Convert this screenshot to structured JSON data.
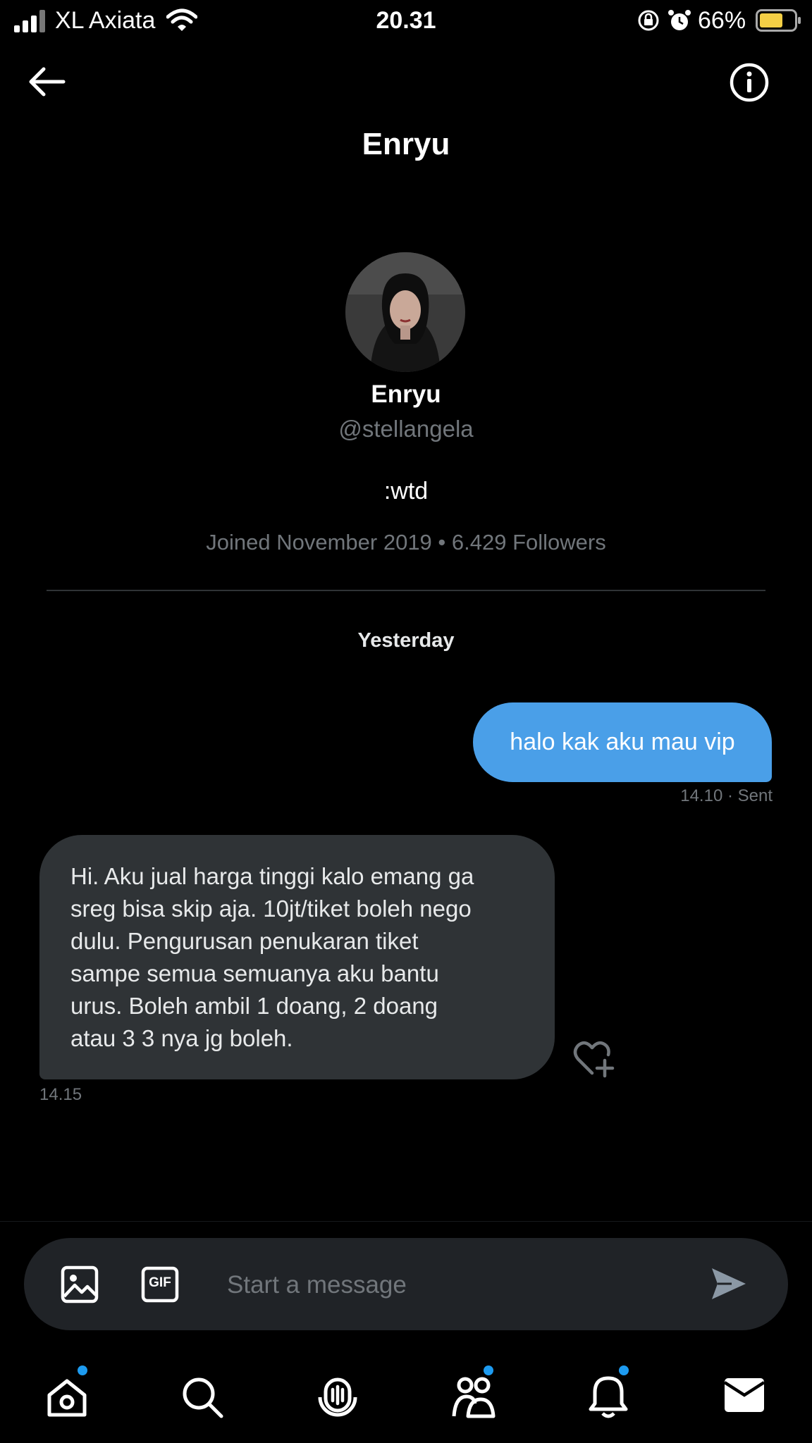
{
  "status_bar": {
    "carrier": "XL Axiata",
    "time": "20.31",
    "battery_percent": "66%",
    "icons": [
      "signal-icon",
      "wifi-icon",
      "orientation-lock-icon",
      "alarm-icon",
      "battery-icon"
    ]
  },
  "header": {
    "title": "Enryu",
    "back_icon": "back-arrow-icon",
    "info_icon": "info-icon"
  },
  "profile": {
    "name": "Enryu",
    "handle": "@stellangela",
    "bio": ":wtd",
    "meta": "Joined November 2019 • 6.429 Followers"
  },
  "conversation": {
    "day_label": "Yesterday",
    "messages": [
      {
        "direction": "sent",
        "text": "halo kak aku mau vip",
        "meta": "14.10 · Sent"
      },
      {
        "direction": "received",
        "lines": [
          "Hi. Aku jual harga tinggi kalo emang ga",
          "sreg bisa skip aja. 10jt/tiket boleh nego",
          "dulu. Pengurusan penukaran tiket",
          "sampe semua semuanya aku bantu",
          "urus. Boleh ambil 1 doang, 2 doang",
          "atau 3 3 nya jg boleh."
        ],
        "time": "14.15"
      }
    ]
  },
  "composer": {
    "placeholder": "Start a message",
    "gif_label": "GIF"
  },
  "bottom_nav": {
    "items": [
      "home-icon",
      "search-icon",
      "spaces-icon",
      "communities-icon",
      "notifications-icon",
      "messages-icon"
    ]
  },
  "colors": {
    "background": "#000000",
    "sent_bubble": "#4a9fe8",
    "received_bubble": "#2f3336",
    "muted_text": "#71767b",
    "notification_dot": "#1d9bf0"
  }
}
